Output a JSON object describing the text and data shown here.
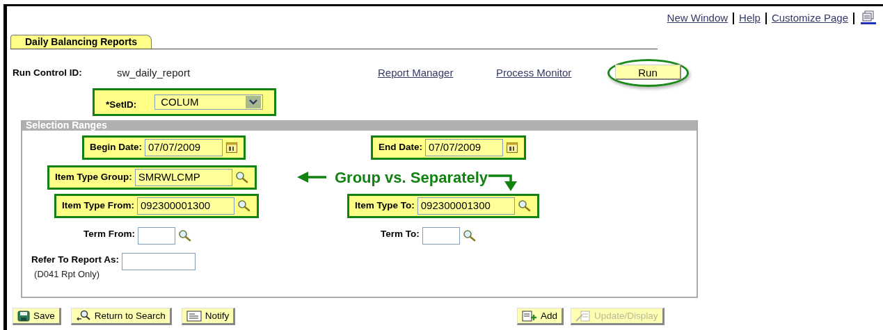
{
  "header_links": [
    {
      "label": "New Window"
    },
    {
      "label": "Help"
    },
    {
      "label": "Customize Page"
    }
  ],
  "tabs": [
    {
      "label": "Daily Balancing Reports",
      "selected": true
    }
  ],
  "run_control": {
    "label": "Run Control ID:",
    "value": "sw_daily_report"
  },
  "links": [
    {
      "label": "Report Manager"
    },
    {
      "label": "Process Monitor"
    }
  ],
  "run_button": {
    "label": "Run",
    "highlighted": true
  },
  "setid": {
    "label": "*SetID:",
    "value": "COLUM",
    "highlighted": true
  },
  "section": {
    "title": "Selection Ranges",
    "rows": [
      [
        {
          "label": "Begin Date:",
          "value": "07/07/2009",
          "kind": "date",
          "highlighted": true
        },
        {
          "label": "End Date:",
          "value": "07/07/2009",
          "kind": "date",
          "highlighted": true
        }
      ],
      [
        {
          "label": "Item Type Group:",
          "value": "SMRWLCMP",
          "kind": "lookup",
          "highlighted": true
        }
      ],
      [
        {
          "label": "Item Type From:",
          "value": "092300001300",
          "kind": "lookup",
          "highlighted": true
        },
        {
          "label": "Item Type To:",
          "value": "092300001300",
          "kind": "lookup",
          "highlighted": true
        }
      ],
      [
        {
          "label": "Term From:",
          "kind": "lookup",
          "highlighted": false
        },
        {
          "label": "Term To:",
          "kind": "lookup",
          "highlighted": false
        }
      ],
      [
        {
          "label": "Refer To Report As:",
          "note": "(D041 Rpt Only)",
          "kind": "text",
          "highlighted": false
        }
      ]
    ]
  },
  "annotation": {
    "text": "Group vs. Separately"
  },
  "buttons_left": [
    {
      "label": "Save",
      "kind": "save",
      "disabled": false
    },
    {
      "label": "Return to Search",
      "kind": "search",
      "disabled": false
    },
    {
      "label": "Notify",
      "kind": "notify",
      "disabled": false
    }
  ],
  "buttons_right": [
    {
      "label": "Add",
      "kind": "add",
      "disabled": false
    },
    {
      "label": "Update/Display",
      "kind": "update",
      "disabled": true
    }
  ]
}
